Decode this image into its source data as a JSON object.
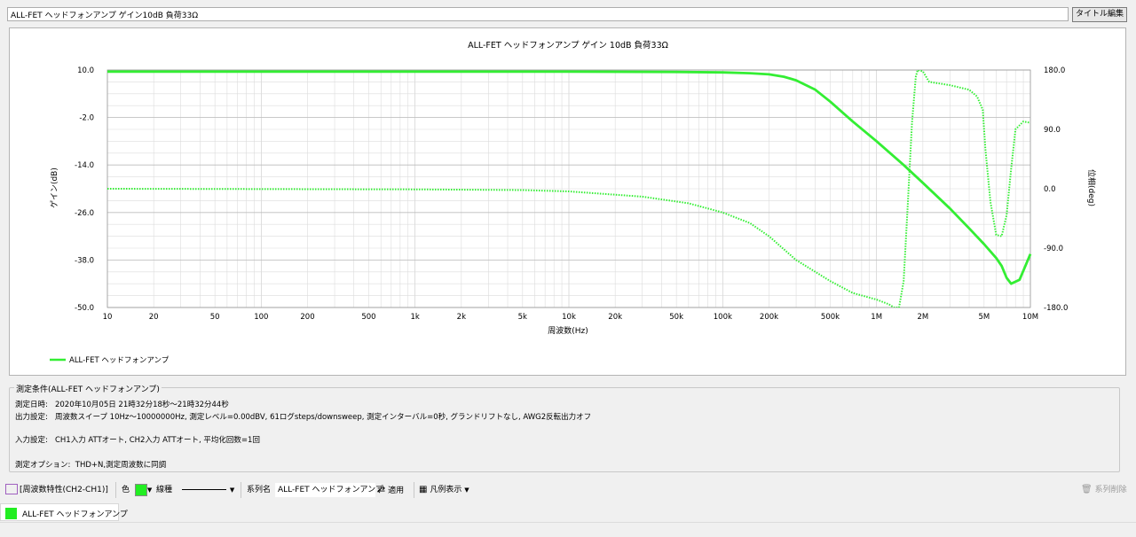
{
  "title_field": {
    "value": "ALL-FET ヘッドフォンアンプ ゲイン10dB 負荷33Ω"
  },
  "edit_title_button": "タイトル編集",
  "colors": {
    "trace": "#33ee33",
    "grid": "#dcdcdc",
    "axis": "#999999"
  },
  "chart_data": {
    "type": "line",
    "title": "ALL-FET ヘッドフォンアンプ ゲイン 10dB 負荷33Ω",
    "xlabel": "周波数(Hz)",
    "ylabel": "ゲイン(dB)",
    "y2label": "位相(deg)",
    "xscale": "log",
    "xlim": [
      10,
      10000000
    ],
    "ylim": [
      -50,
      10
    ],
    "y2lim": [
      -180,
      180
    ],
    "grid": true,
    "legend_position": "bottom-left",
    "x_ticks": [
      {
        "v": 10,
        "label": "10"
      },
      {
        "v": 20,
        "label": "20"
      },
      {
        "v": 50,
        "label": "50"
      },
      {
        "v": 100,
        "label": "100"
      },
      {
        "v": 200,
        "label": "200"
      },
      {
        "v": 500,
        "label": "500"
      },
      {
        "v": 1000,
        "label": "1k"
      },
      {
        "v": 2000,
        "label": "2k"
      },
      {
        "v": 5000,
        "label": "5k"
      },
      {
        "v": 10000,
        "label": "10k"
      },
      {
        "v": 20000,
        "label": "20k"
      },
      {
        "v": 50000,
        "label": "50k"
      },
      {
        "v": 100000,
        "label": "100k"
      },
      {
        "v": 200000,
        "label": "200k"
      },
      {
        "v": 500000,
        "label": "500k"
      },
      {
        "v": 1000000,
        "label": "1M"
      },
      {
        "v": 2000000,
        "label": "2M"
      },
      {
        "v": 5000000,
        "label": "5M"
      },
      {
        "v": 10000000,
        "label": "10M"
      }
    ],
    "y_ticks": [
      {
        "v": 10,
        "label": "10.0"
      },
      {
        "v": -2,
        "label": "-2.0"
      },
      {
        "v": -14,
        "label": "-14.0"
      },
      {
        "v": -26,
        "label": "-26.0"
      },
      {
        "v": -38,
        "label": "-38.0"
      },
      {
        "v": -50,
        "label": "-50.0"
      }
    ],
    "y2_ticks": [
      {
        "v": 180,
        "label": "180.0"
      },
      {
        "v": 90,
        "label": "90.0"
      },
      {
        "v": 0,
        "label": "0.0"
      },
      {
        "v": -90,
        "label": "-90.0"
      },
      {
        "v": -180,
        "label": "-180.0"
      }
    ],
    "series": [
      {
        "name": "ALL-FET ヘッドフォンアンプ",
        "gain_db": {
          "x": [
            10,
            100,
            1000,
            10000,
            50000,
            100000,
            150000,
            200000,
            250000,
            300000,
            400000,
            500000,
            700000,
            1000000,
            1500000,
            2000000,
            3000000,
            4000000,
            5000000,
            6000000,
            6500000,
            7000000,
            7500000,
            8500000,
            10000000
          ],
          "y": [
            9.6,
            9.6,
            9.6,
            9.6,
            9.5,
            9.4,
            9.2,
            8.9,
            8.3,
            7.4,
            5.0,
            2.0,
            -3.0,
            -8.0,
            -14.0,
            -18.5,
            -25.0,
            -30.0,
            -34.0,
            -37.5,
            -39.5,
            -42.5,
            -44.0,
            -43.0,
            -36.5
          ]
        },
        "phase_deg": {
          "x": [
            10,
            1000,
            5000,
            10000,
            30000,
            60000,
            100000,
            150000,
            200000,
            300000,
            500000,
            700000,
            1000000,
            1200000,
            1300000,
            1400000,
            1500000,
            1600000,
            1700000,
            1800000,
            1850000,
            2000000,
            2200000,
            3000000,
            4000000,
            4500000,
            4900000,
            5100000,
            5500000,
            6000000,
            6500000,
            7000000,
            7500000,
            8000000,
            9000000,
            10000000
          ],
          "y": [
            0,
            -1,
            -2,
            -4,
            -12,
            -22,
            -36,
            -52,
            -72,
            -108,
            -140,
            -158,
            -168,
            -175,
            -180,
            -180,
            -140,
            -20,
            100,
            170,
            180,
            178,
            162,
            157,
            150,
            140,
            120,
            60,
            -20,
            -70,
            -72,
            -40,
            30,
            90,
            102,
            100
          ]
        }
      }
    ]
  },
  "conditions": {
    "group_title": "測定条件(ALL-FET ヘッドフォンアンプ)",
    "date_line": "測定日時:   2020年10月05日 21時32分18秒〜21時32分44秒",
    "output_line": "出力設定:   周波数スイープ 10Hz〜10000000Hz, 測定レベル=0.00dBV, 61ログsteps/downsweep, 測定インターバル=0秒, グランドリフトなし, AWG2反転出力オフ",
    "input_line": "入力設定:   CH1入力 ATTオート, CH2入力 ATTオート, 平均化回数=1回",
    "option_line": "測定オプション:  THD+N,測定周波数に同調"
  },
  "toolbar": {
    "mode_label": "[周波数特性(CH2-CH1)]",
    "color_label": "色",
    "linetype_label": "線種",
    "series_name_label": "系列名",
    "series_name_value": "ALL-FET ヘッドフォンアンプ",
    "apply_label": "適用",
    "legend_label": "凡例表示",
    "delete_label": "系列削除"
  },
  "legend_tab": {
    "label": "ALL-FET ヘッドフォンアンプ"
  }
}
